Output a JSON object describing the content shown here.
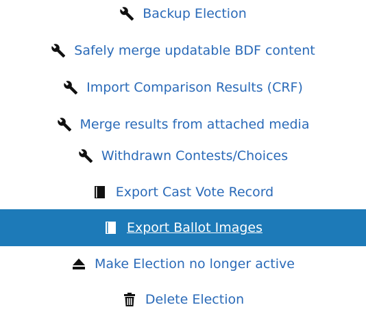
{
  "menu": {
    "items": [
      {
        "label": "Backup Election",
        "icon": "wrench-icon"
      },
      {
        "label": "Safely merge updatable BDF content",
        "icon": "wrench-icon"
      },
      {
        "label": "Import Comparison Results (CRF)",
        "icon": "wrench-icon"
      },
      {
        "label": "Merge results from attached media",
        "icon": "wrench-icon"
      },
      {
        "label": "Withdrawn Contests/Choices",
        "icon": "wrench-icon"
      },
      {
        "label": "Export Cast Vote Record",
        "icon": "book-icon"
      },
      {
        "label": "Export Ballot Images",
        "icon": "book-icon",
        "active": true
      },
      {
        "label": "Make Election no longer active",
        "icon": "eject-icon"
      },
      {
        "label": "Delete Election",
        "icon": "trash-icon"
      }
    ]
  },
  "colors": {
    "link": "#2a6ab8",
    "active_bg": "#1d7ab8",
    "active_text": "#ffffff"
  }
}
